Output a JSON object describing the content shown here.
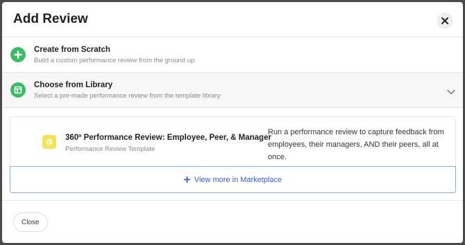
{
  "modal": {
    "title": "Add Review",
    "close_icon": "close-icon"
  },
  "options": {
    "scratch": {
      "title": "Create from Scratch",
      "subtitle": "Build a custom performance review from the ground up",
      "icon": "plus-circle-icon",
      "icon_color": "#3dba64"
    },
    "library": {
      "title": "Choose from Library",
      "subtitle": "Select a pre-made performance review from the template library",
      "icon": "template-layout-icon",
      "icon_color": "#3dba64",
      "expanded_icon": "chevron-down-icon"
    }
  },
  "template": {
    "title": "360º Performance Review: Employee, Peer, & Manager",
    "subtitle": "Performance Review Template",
    "description": "Run a performance review to capture feedback from employees, their managers, AND their peers, all at once.",
    "icon": "review-template-icon",
    "icon_color": "#f2e35a"
  },
  "marketplace": {
    "label": "View more in Marketplace",
    "icon": "plus-icon",
    "accent": "#3a5bc7"
  },
  "footer": {
    "close_label": "Close"
  }
}
